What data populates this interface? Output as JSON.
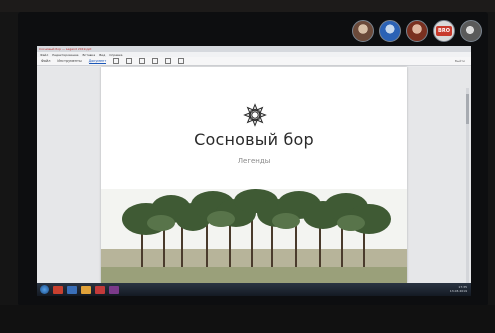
{
  "call": {
    "participants": [
      {
        "name": "participant-1"
      },
      {
        "name": "participant-2"
      },
      {
        "name": "participant-3"
      },
      {
        "name": "participant-4",
        "badge": "BRO"
      },
      {
        "name": "participant-5"
      }
    ]
  },
  "app": {
    "title": "Сосновый бор — Legend 2019.ppt",
    "menu": [
      "Файл",
      "Редактирование",
      "Вставка",
      "Вид",
      "Справка"
    ],
    "ribbon_tabs": [
      "Файл",
      "Инструменты",
      "Документ"
    ],
    "active_tab": "Документ",
    "ribbon_right_label": "Выйти"
  },
  "document": {
    "title": "Сосновый бор",
    "subtitle": "Легенды"
  },
  "taskbar": {
    "clock_time": "17:35",
    "clock_date": "13.03.2019"
  },
  "colors": {
    "accent": "#1b57b8",
    "taskbar": "#1a2230",
    "page": "#ffffff"
  }
}
